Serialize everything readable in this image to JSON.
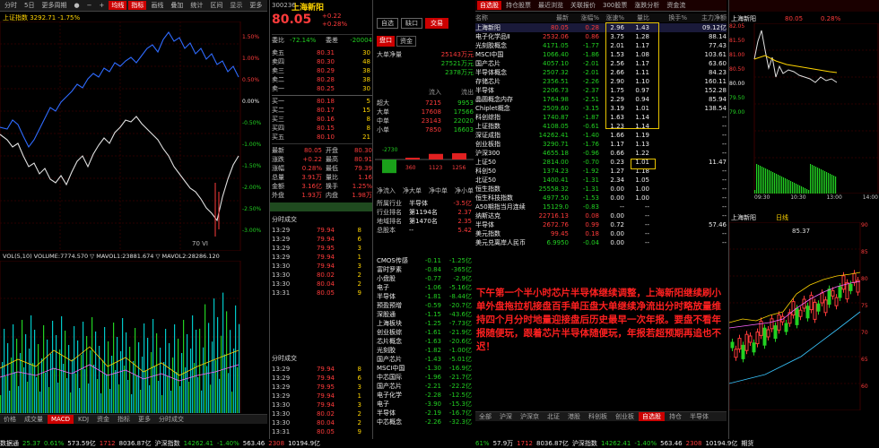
{
  "left_tabs": [
    "分时",
    "5日",
    "更多周期",
    "●",
    "−",
    "+",
    "均线",
    "指标",
    "画线",
    "叠加",
    "统计",
    "区间",
    "显示",
    "更多",
    "复权"
  ],
  "left_legend": "上证指数 3292.71 -1.75%",
  "left_ylabels": [
    "1.50%",
    "1.00%",
    "0.50%",
    "0.00%",
    "-0.50%",
    "-1.00%",
    "-1.50%",
    "-2.00%",
    "-2.50%",
    "-3.00%"
  ],
  "left_vol_label": "VOL(5,10) VOLUME:7774.570 ▽ MAVOL1:23881.674 ▽ MAVOL2:28286.120",
  "left_bottom_tabs": [
    "价格",
    "成交量",
    "MACD",
    "KDJ",
    "资金",
    "指标",
    "更多",
    "分时成交",
    "融资融券",
    "资金流向",
    "大单",
    "机构",
    "龙虎",
    "Ami",
    "Pmt"
  ],
  "status_left": {
    "index": "数据通",
    "v1": "25.37",
    "v2": "0.61%",
    "v3": "573.59亿",
    "v4": "1712",
    "v5": "8036.87亿",
    "index2": "沪深指数",
    "v6": "14262.41",
    "v7": "-1.40%",
    "v8": "563.46",
    "v9": "2308",
    "v10": "10194.9亿"
  },
  "quote": {
    "code": "300236",
    "name": "上海新阳",
    "price": "80.05",
    "chg": "+0.22",
    "pct": "+0.28%",
    "btn1": "自选",
    "btn2": "缺口",
    "btn3": "交易"
  },
  "quote_head": {
    "label1": "委比",
    "weibi": "-72.14%",
    "label2": "委差",
    "weicha": "-20004",
    "tag1": "盘口",
    "tag2": "资金"
  },
  "sell": [
    {
      "l": "卖五",
      "p": "80.31",
      "v": "30"
    },
    {
      "l": "卖四",
      "p": "80.30",
      "v": "48"
    },
    {
      "l": "卖三",
      "p": "80.29",
      "v": "38"
    },
    {
      "l": "卖二",
      "p": "80.28",
      "v": "38"
    },
    {
      "l": "卖一",
      "p": "80.25",
      "v": "30"
    }
  ],
  "buy": [
    {
      "l": "买一",
      "p": "80.18",
      "v": "5"
    },
    {
      "l": "买二",
      "p": "80.17",
      "v": "15"
    },
    {
      "l": "买三",
      "p": "80.16",
      "v": "8"
    },
    {
      "l": "买四",
      "p": "80.15",
      "v": "8"
    },
    {
      "l": "买五",
      "p": "80.10",
      "v": "21"
    }
  ],
  "quote_stats": [
    {
      "k": "最新",
      "v": "80.05",
      "k2": "开盘",
      "v2": "80.30"
    },
    {
      "k": "涨跌",
      "v": "+0.22",
      "k2": "最高",
      "v2": "80.91"
    },
    {
      "k": "涨幅",
      "v": "0.28%",
      "k2": "最低",
      "v2": "79.39"
    },
    {
      "k": "总量",
      "v": "3.91万",
      "k2": "量比",
      "v2": "1.16"
    },
    {
      "k": "金额",
      "v": "3.16亿",
      "k2": "换手",
      "v2": "1.25%"
    },
    {
      "k": "外盘",
      "v": "1.93万",
      "k2": "内盘",
      "v2": "1.98万"
    }
  ],
  "big_flow": {
    "label": "大单净量",
    "v1": "25143万元",
    "v2": "27521万元",
    "v3": "2378万元",
    "h1": "流入",
    "h2": "流出",
    "rows": [
      {
        "k": "超大",
        "a": "7215",
        "b": "9953"
      },
      {
        "k": "大单",
        "a": "17608",
        "b": "17566"
      },
      {
        "k": "中单",
        "a": "23143",
        "b": "22020"
      },
      {
        "k": "小单",
        "a": "7850",
        "b": "16603"
      }
    ]
  },
  "flow_bar": {
    "values": [
      "-2730",
      "360",
      "1123",
      "1256"
    ]
  },
  "flow_tabs": [
    "净流入",
    "净大单",
    "净中单",
    "净小单"
  ],
  "rank": [
    {
      "k": "所属行业",
      "v": "半导体",
      "r": "-3.5亿"
    },
    {
      "k": "行业排名",
      "v": "第1194名",
      "r": "2.37"
    },
    {
      "k": "地域排名",
      "v": "第1470名",
      "r": "2.35"
    },
    {
      "k": "总股本",
      "v": "--",
      "r": "5.42"
    }
  ],
  "ticks_head": "分时成交",
  "ticks": [
    {
      "t": "13:29",
      "p": "79.94",
      "v": "8"
    },
    {
      "t": "13:29",
      "p": "79.94",
      "v": "6"
    },
    {
      "t": "13:29",
      "p": "79.95",
      "v": "3"
    },
    {
      "t": "13:29",
      "p": "79.94",
      "v": "1"
    },
    {
      "t": "13:30",
      "p": "79.94",
      "v": "3"
    },
    {
      "t": "13:30",
      "p": "80.02",
      "v": "2"
    },
    {
      "t": "13:30",
      "p": "80.04",
      "v": "2"
    },
    {
      "t": "13:31",
      "p": "80.05",
      "v": "9"
    }
  ],
  "pan_list": [
    {
      "n": "CMOS传感",
      "a": "-0.11",
      "b": "-1.25亿"
    },
    {
      "n": "富时罗素",
      "a": "-0.84",
      "b": "-365亿"
    },
    {
      "n": "小盘股",
      "a": "-0.77",
      "b": "-2.9亿"
    },
    {
      "n": "电子",
      "a": "-1.06",
      "b": "-5.16亿"
    },
    {
      "n": "半导体",
      "a": "-1.81",
      "b": "-8.44亿"
    },
    {
      "n": "预盈预增",
      "a": "-0.59",
      "b": "-20.7亿"
    },
    {
      "n": "深股通",
      "a": "-1.15",
      "b": "-43.6亿"
    },
    {
      "n": "上海板块",
      "a": "-1.25",
      "b": "-7.73亿"
    },
    {
      "n": "创业板综",
      "a": "-1.61",
      "b": "-21.9亿"
    },
    {
      "n": "芯片概念",
      "a": "-1.63",
      "b": "-20.6亿"
    },
    {
      "n": "光刻胶",
      "a": "-1.82",
      "b": "-1.00亿"
    },
    {
      "n": "国产芯片",
      "a": "-1.43",
      "b": "-5.01亿"
    },
    {
      "n": "MSCI中国",
      "a": "-1.30",
      "b": "-16.9亿"
    },
    {
      "n": "中芯国际",
      "a": "-1.96",
      "b": "-21.7亿"
    },
    {
      "n": "国产芯片",
      "a": "-2.21",
      "b": "-22.2亿"
    },
    {
      "n": "电子化学",
      "a": "-2.28",
      "b": "-12.5亿"
    },
    {
      "n": "电子",
      "a": "-3.90",
      "b": "-15.3亿"
    },
    {
      "n": "半导体",
      "a": "-2.19",
      "b": "-16.7亿"
    },
    {
      "n": "中芯概念",
      "a": "-2.26",
      "b": "-32.3亿"
    }
  ],
  "table_tabs": [
    "自选股",
    "持仓股票",
    "最近浏览",
    "关联报价",
    "300股票",
    "涨跌分析",
    "资金流",
    "个股报价",
    "龙虎榜",
    "全部A股",
    "多股同列"
  ],
  "table_head": [
    "名称",
    "最新",
    "涨幅%",
    "涨速%",
    "量比",
    "换手%",
    "主力净额"
  ],
  "table": [
    {
      "n": "上海新阳",
      "p": "80.05",
      "c": "0.28",
      "s": "2.96",
      "q": "1.43",
      "h": "",
      "m": "09.12亿",
      "z": "250.9亿"
    },
    {
      "n": "电子化学品Ⅱ",
      "p": "2532.06",
      "c": "0.86",
      "s": "3.75",
      "q": "1.28",
      "h": "",
      "m": "88.14",
      "z": "5166亿"
    },
    {
      "n": "光刻胶概念",
      "p": "4171.05",
      "c": "-1.77",
      "s": "2.01",
      "q": "1.17",
      "h": "",
      "m": "77.43",
      "z": "1.17万亿"
    },
    {
      "n": "MSCI中国",
      "p": "1066.40",
      "c": "-1.86",
      "s": "1.53",
      "q": "1.08",
      "h": "",
      "m": "103.61",
      "z": "1.41万亿"
    },
    {
      "n": "国产芯片",
      "p": "4057.10",
      "c": "-2.01",
      "s": "2.56",
      "q": "1.17",
      "h": "",
      "m": "63.60",
      "z": "13.00万亿"
    },
    {
      "n": "半导体概念",
      "p": "2507.32",
      "c": "-2.01",
      "s": "2.66",
      "q": "1.11",
      "h": "",
      "m": "84.23",
      "z": "5.12万亿"
    },
    {
      "n": "存储芯片",
      "p": "2356.51",
      "c": "-2.26",
      "s": "2.90",
      "q": "1.10",
      "h": "",
      "m": "160.11",
      "z": "4.37万亿"
    },
    {
      "n": "半导体",
      "p": "2206.73",
      "c": "-2.37",
      "s": "1.75",
      "q": "0.97",
      "h": "",
      "m": "152.28",
      "z": "7.85万亿"
    },
    {
      "n": "晶圆概念内存",
      "p": "1764.98",
      "c": "-2.51",
      "s": "2.29",
      "q": "0.94",
      "h": "",
      "m": "85.94",
      "z": "1.39万亿"
    },
    {
      "n": "Chiplet概念",
      "p": "2509.60",
      "c": "-3.15",
      "s": "3.19",
      "q": "1.01",
      "h": "",
      "m": "138.54",
      "z": "1.11万亿"
    },
    {
      "n": "科创综指",
      "p": "1740.87",
      "c": "-1.87",
      "s": "1.63",
      "q": "1.14",
      "h": "",
      "m": "--",
      "z": "11.07万亿"
    },
    {
      "n": "上证指数",
      "p": "4108.05",
      "c": "-0.61",
      "s": "1.23",
      "q": "1.14",
      "h": "",
      "m": "--",
      "z": "64.62万亿"
    },
    {
      "n": "深证成指",
      "p": "14262.41",
      "c": "-1.40",
      "s": "1.66",
      "q": "1.19",
      "h": "",
      "m": "--",
      "z": "46.74万亿"
    },
    {
      "n": "创业板指",
      "p": "3290.71",
      "c": "-1.76",
      "s": "1.17",
      "q": "1.13",
      "h": "",
      "m": "--",
      "z": "17.93万亿"
    },
    {
      "n": "沪深300",
      "p": "4655.18",
      "c": "-0.96",
      "s": "0.66",
      "q": "1.22",
      "h": "",
      "m": "--",
      "z": "54.06万亿"
    },
    {
      "n": "上证50",
      "p": "2814.00",
      "c": "-0.70",
      "s": "0.23",
      "q": "1.01",
      "h": "",
      "m": "11.47",
      "z": "20.29万亿"
    },
    {
      "n": "科创50",
      "p": "1374.23",
      "c": "-1.92",
      "s": "1.27",
      "q": "1.18",
      "h": "",
      "m": "--",
      "z": "4.07万亿"
    },
    {
      "n": "北证50",
      "p": "1400.41",
      "c": "-1.31",
      "s": "2.34",
      "q": "1.05",
      "h": "",
      "m": "--",
      "z": "9020亿"
    },
    {
      "n": "恒生指数",
      "p": "25558.32",
      "c": "-1.31",
      "s": "0.00",
      "q": "1.00",
      "h": "",
      "m": "--",
      "z": ""
    },
    {
      "n": "恒生科技指数",
      "p": "4977.50",
      "c": "-1.53",
      "s": "0.00",
      "q": "1.00",
      "h": "",
      "m": "--",
      "z": ""
    },
    {
      "n": "A50期指当月连续",
      "p": "15129.0",
      "c": "-0.83",
      "s": "--",
      "q": "--",
      "h": "",
      "m": "--",
      "z": ""
    },
    {
      "n": "纳斯达克",
      "p": "22716.13",
      "c": "0.08",
      "s": "0.00",
      "q": "--",
      "h": "",
      "m": "--",
      "z": ""
    },
    {
      "n": "半导体",
      "p": "2672.76",
      "c": "0.99",
      "s": "0.72",
      "q": "--",
      "h": "",
      "m": "57.46",
      "z": ""
    },
    {
      "n": "美元指数",
      "p": "99.45",
      "c": "0.18",
      "s": "0.00",
      "q": "--",
      "h": "",
      "m": "--",
      "z": ""
    },
    {
      "n": "美元兑离岸人民币",
      "p": "6.9950",
      "c": "-0.04",
      "s": "0.00",
      "q": "--",
      "h": "",
      "m": "--",
      "z": ""
    }
  ],
  "annotation": "下午第一个半小时芯片半导体继续调整，上海新阳继续刷小单外盘拖拉机接盘百手单压盘大单继续净流出分时略放量维持四个月分时地量迎接盘后历史最早一次年报。要盘不看年报随便玩，跟着芯片半导体随便玩，年报若超预期再追也不迟！",
  "table_bottom_tabs": [
    "全部",
    "沪深",
    "沪深京",
    "北证",
    "港股",
    "科创板",
    "创业板",
    "自选股",
    "持仓",
    "半导体",
    "指数",
    "个股",
    "板块",
    "期货"
  ],
  "mini": {
    "name": "上海新阳",
    "price": "80.05",
    "pct": "0.28%",
    "yl": [
      "82.05",
      "81.50",
      "81.00",
      "80.50",
      "80.00",
      "79.50",
      "79.00"
    ],
    "xl": [
      "09:30",
      "10:30",
      "13:00",
      "14:00"
    ],
    "tab_label": "分时"
  },
  "mini_k": {
    "name": "上海新阳",
    "label": "日线",
    "yl": [
      "90",
      "85",
      "80",
      "75",
      "70",
      "65",
      "60"
    ],
    "price_tag": "85.37"
  },
  "status_right": {
    "a": "61%",
    "b": "57.9万",
    "c": "1712",
    "d": "8036.87亿",
    "e": "沪深指数",
    "f": "14262.41",
    "g": "-1.40%",
    "h": "563.46",
    "i": "2308",
    "j": "10194.9亿",
    "k": "期货"
  }
}
